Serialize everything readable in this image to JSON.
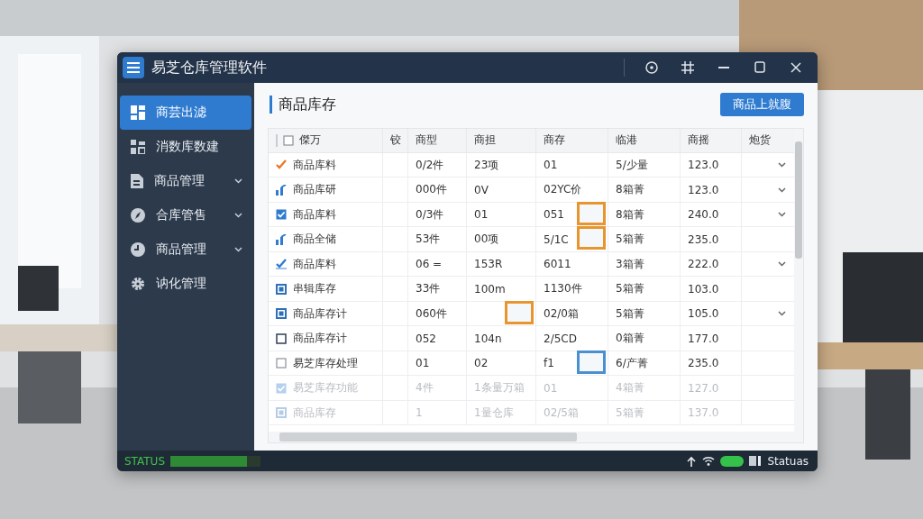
{
  "window": {
    "title": "易芝仓库管理软件"
  },
  "sidebar": {
    "items": [
      {
        "label": "商芸出滤",
        "selected": true,
        "chevron": false
      },
      {
        "label": "消数库数建",
        "selected": false,
        "chevron": false
      },
      {
        "label": "商品管理",
        "selected": false,
        "chevron": true
      },
      {
        "label": "合库管售",
        "selected": false,
        "chevron": true
      },
      {
        "label": "商品管理",
        "selected": false,
        "chevron": true
      },
      {
        "label": "讷化管理",
        "selected": false,
        "chevron": false
      }
    ]
  },
  "content": {
    "title": "商品库存",
    "button": "商品上就腹"
  },
  "table": {
    "columns": [
      "傑万",
      "铰",
      "商型",
      "商担",
      "商存",
      "临港",
      "商摇",
      "炮货"
    ],
    "rows": [
      {
        "kind": "tick",
        "disabled": false,
        "dropdown": true,
        "cells": [
          "商品库料",
          "",
          "0/2件",
          "23项",
          "01",
          "5/少量",
          "123.0"
        ]
      },
      {
        "kind": "bars",
        "disabled": false,
        "dropdown": true,
        "cells": [
          "商品库研",
          "",
          "000件",
          "0V",
          "02YC价",
          "8箱菁",
          "123.0"
        ]
      },
      {
        "kind": "checked",
        "disabled": false,
        "dropdown": true,
        "cells": [
          "商品库料",
          "",
          "0/3件",
          "01",
          {
            "text": "051",
            "thumbnail": {
              "color": "#e8952f"
            }
          },
          "8箱菁",
          "240.0"
        ]
      },
      {
        "kind": "bars",
        "disabled": false,
        "dropdown": false,
        "cells": [
          "商品全储",
          "",
          "53件",
          "00项",
          {
            "text": "5/1C",
            "thumbnail": {
              "color": "#e8952f"
            }
          },
          "5箱菁",
          "235.0"
        ]
      },
      {
        "kind": "tick-box",
        "disabled": false,
        "dropdown": true,
        "cells": [
          "商品库料",
          "",
          "06 =",
          "153R",
          "6011",
          "3箱菁",
          "222.0"
        ]
      },
      {
        "kind": "square",
        "disabled": false,
        "dropdown": false,
        "cells": [
          "串辑库存",
          "",
          "33件",
          "100m",
          "1130件",
          "5箱菁",
          "103.0"
        ]
      },
      {
        "kind": "square",
        "disabled": false,
        "dropdown": true,
        "cells": [
          "商品库存计",
          "",
          "060件",
          {
            "text": "",
            "thumbnail": {
              "color": "#e8952f"
            }
          },
          "02/0箱",
          "5箱菁",
          "105.0"
        ]
      },
      {
        "kind": "outline",
        "disabled": false,
        "dropdown": false,
        "cells": [
          "商品库存计",
          "",
          "052",
          "104n",
          "2/5CD",
          "0箱菁",
          "177.0"
        ]
      },
      {
        "kind": "empty",
        "disabled": false,
        "dropdown": false,
        "cells": [
          "易芝库存处理",
          "",
          "01",
          "02",
          {
            "text": "f1",
            "thumbnail": {
              "color": "#4a90d0"
            }
          },
          "6/产菁",
          "235.0"
        ]
      },
      {
        "kind": "checked",
        "disabled": true,
        "dropdown": false,
        "cells": [
          "易芝库存功能",
          "",
          "4件",
          "1条量万箱",
          "01",
          "4箱菁",
          "127.0"
        ]
      },
      {
        "kind": "square",
        "disabled": true,
        "dropdown": false,
        "cells": [
          "商品库存",
          "",
          "1",
          "1量仓库",
          "02/5箱",
          "5箱菁",
          "137.0"
        ]
      }
    ]
  },
  "status_bar": {
    "label": "STATUS",
    "level": 0.85,
    "toggle_on": true,
    "text": "Statuas"
  }
}
